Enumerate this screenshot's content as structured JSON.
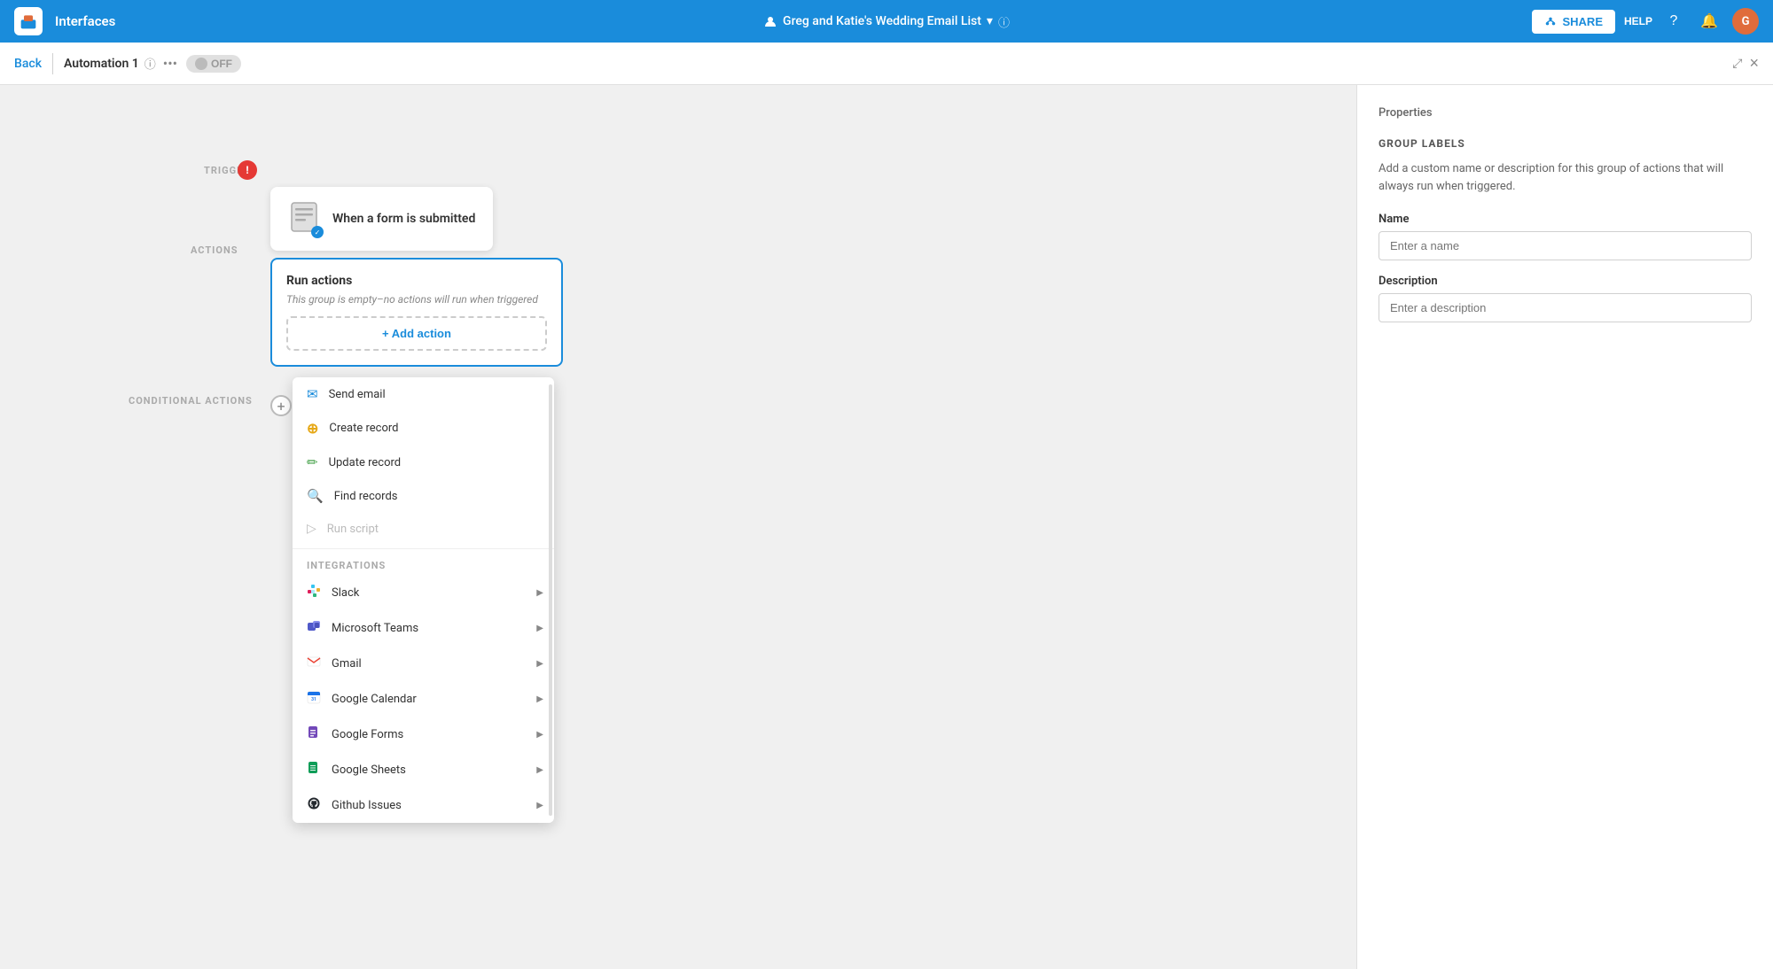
{
  "app": {
    "logo_alt": "Airtable logo",
    "nav_title": "Interfaces"
  },
  "header": {
    "project_name": "Greg and Katie's Wedding Email List",
    "dropdown_icon": "▾",
    "info_icon": "ⓘ",
    "share_label": "SHARE",
    "help_label": "HELP"
  },
  "sub_nav": {
    "back_label": "Back",
    "automation_name": "Automation 1",
    "toggle_label": "OFF"
  },
  "canvas": {
    "trigger_label": "TRIGGER",
    "actions_label": "ACTIONS",
    "conditional_actions_label": "CONDITIONAL ACTIONS",
    "trigger_card": {
      "text": "When a form is submitted"
    },
    "run_actions": {
      "title": "Run actions",
      "subtitle": "This group is empty–no actions will run when triggered",
      "add_action_label": "+ Add action"
    }
  },
  "action_menu": {
    "items": [
      {
        "id": "send-email",
        "label": "Send email",
        "icon": "email",
        "disabled": false
      },
      {
        "id": "create-record",
        "label": "Create record",
        "icon": "create",
        "disabled": false
      },
      {
        "id": "update-record",
        "label": "Update record",
        "icon": "update",
        "disabled": false
      },
      {
        "id": "find-records",
        "label": "Find records",
        "icon": "find",
        "disabled": false
      },
      {
        "id": "run-script",
        "label": "Run script",
        "icon": "script",
        "disabled": true
      }
    ],
    "integrations_label": "INTEGRATIONS",
    "integrations": [
      {
        "id": "slack",
        "label": "Slack",
        "has_submenu": true
      },
      {
        "id": "microsoft-teams",
        "label": "Microsoft Teams",
        "has_submenu": true
      },
      {
        "id": "gmail",
        "label": "Gmail",
        "has_submenu": true
      },
      {
        "id": "google-calendar",
        "label": "Google Calendar",
        "has_submenu": true
      },
      {
        "id": "google-forms",
        "label": "Google Forms",
        "has_submenu": true
      },
      {
        "id": "google-sheets",
        "label": "Google Sheets",
        "has_submenu": true
      },
      {
        "id": "github-issues",
        "label": "Github Issues",
        "has_submenu": true
      }
    ]
  },
  "properties": {
    "panel_title": "Properties",
    "section_title": "GROUP LABELS",
    "description": "Add a custom name or description for this group of actions that will always run when triggered.",
    "name_label": "Name",
    "name_placeholder": "Enter a name",
    "description_label": "Description",
    "description_placeholder": "Enter a description"
  }
}
